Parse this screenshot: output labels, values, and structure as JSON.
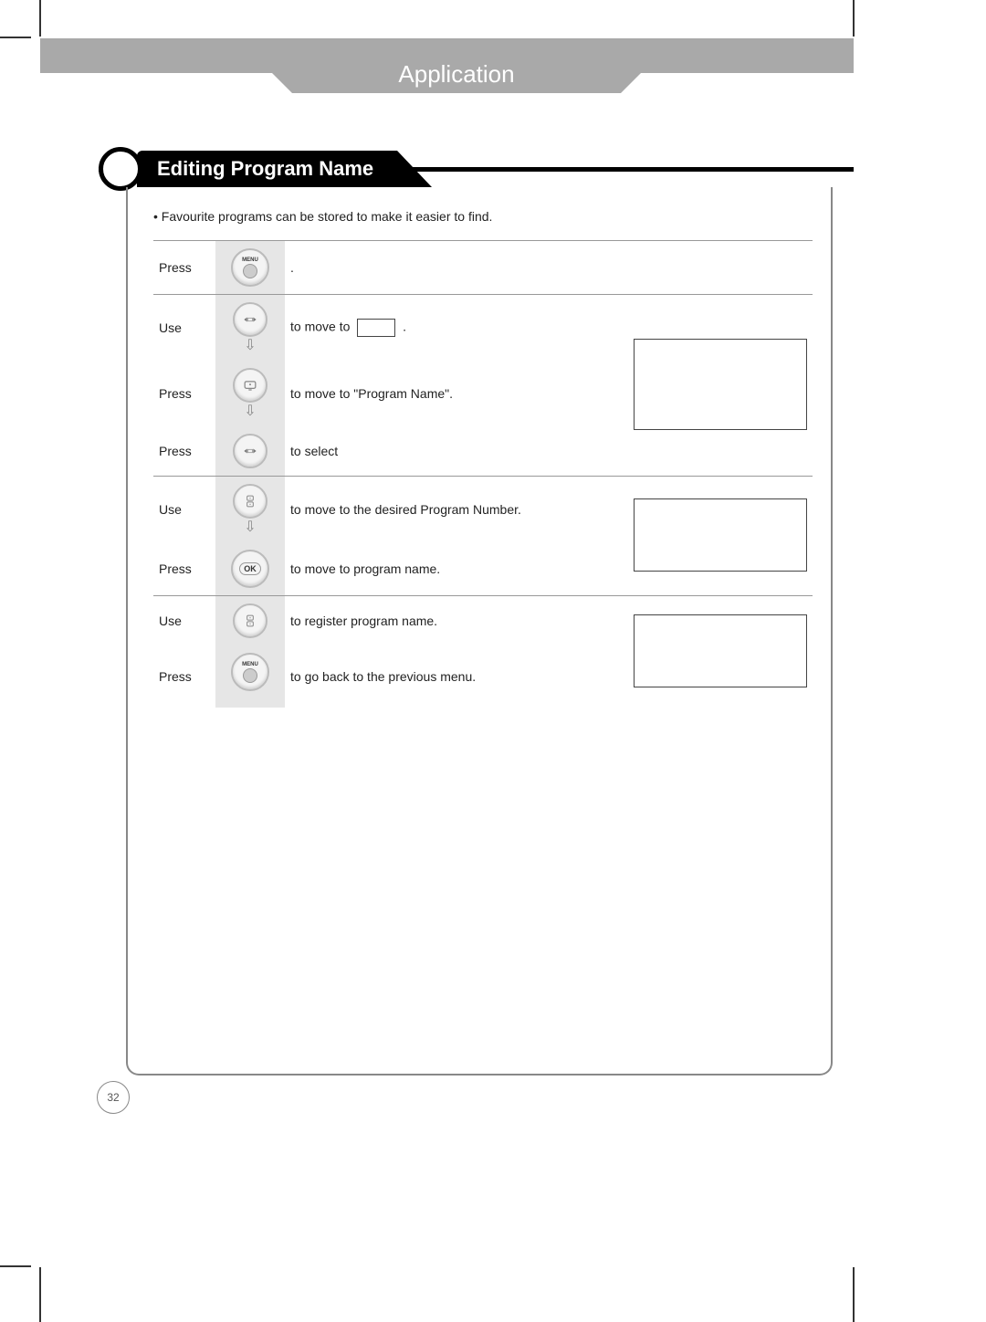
{
  "header": {
    "chapter": "Application"
  },
  "section": {
    "title": "Editing Program Name"
  },
  "intro": "• Favourite programs can be stored to make it easier to find.",
  "labels": {
    "press": "Press",
    "use": "Use"
  },
  "steps": [
    {
      "action": "press",
      "button": "menu",
      "desc_after": "."
    },
    {
      "action": "use",
      "button": "lr-arrows",
      "desc_before": "to move to",
      "has_inline_box": true,
      "desc_after": ".",
      "arrow_after": true
    },
    {
      "action": "press",
      "button": "tv",
      "desc": "to move to \"Program Name\".",
      "arrow_after": true
    },
    {
      "action": "press",
      "button": "lr-arrows",
      "desc": "to select"
    },
    {
      "action": "use",
      "button": "updown",
      "desc": "to  move to the desired Program Number.",
      "arrow_after": true
    },
    {
      "action": "press",
      "button": "ok",
      "desc": "to move to program name."
    },
    {
      "action": "use",
      "button": "updown",
      "desc": "to register program name."
    },
    {
      "action": "press",
      "button": "menu",
      "desc": "to go back to the previous menu."
    }
  ],
  "buttons": {
    "menu_label": "MENU",
    "ok_label": "OK"
  },
  "page_number": "32"
}
